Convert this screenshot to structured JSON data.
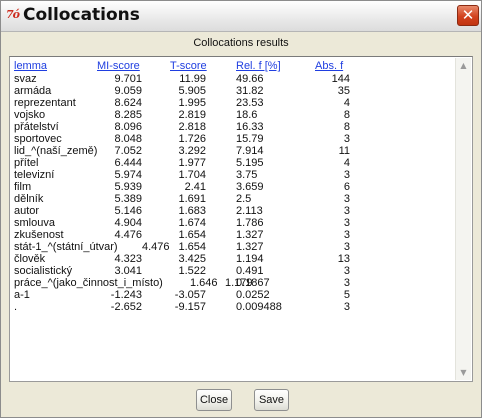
{
  "window": {
    "app_icon": "7ó",
    "title": "Collocations",
    "close_glyph": "✕"
  },
  "subtitle": "Collocations results",
  "table": {
    "headers": [
      "lemma",
      "MI-score",
      "T-score",
      "Rel. f [%]",
      "Abs. f"
    ],
    "rows": [
      [
        "svaz",
        "9.701",
        "11.99",
        "49.66",
        "144"
      ],
      [
        "armáda",
        "9.059",
        "5.905",
        "31.82",
        "35"
      ],
      [
        "reprezentant",
        "8.624",
        "1.995",
        "23.53",
        "4"
      ],
      [
        "vojsko",
        "8.285",
        "2.819",
        "18.6",
        "8"
      ],
      [
        "přátelství",
        "8.096",
        "2.818",
        "16.33",
        "8"
      ],
      [
        "sportovec",
        "8.048",
        "1.726",
        "15.79",
        "3"
      ],
      [
        "lid_^(naší_země)",
        "7.052",
        "3.292",
        "7.914",
        "11"
      ],
      [
        "přítel",
        "6.444",
        "1.977",
        "5.195",
        "4"
      ],
      [
        "televizní",
        "5.974",
        "1.704",
        "3.75",
        "3"
      ],
      [
        "film",
        "5.939",
        "2.41",
        "3.659",
        "6"
      ],
      [
        "dělník",
        "5.389",
        "1.691",
        "2.5",
        "3"
      ],
      [
        "autor",
        "5.146",
        "1.683",
        "2.113",
        "3"
      ],
      [
        "smlouva",
        "4.904",
        "1.674",
        "1.786",
        "3"
      ],
      [
        "zkušenost",
        "4.476",
        "1.654",
        "1.327",
        "3"
      ],
      [
        "stát-1_^(státní_útvar)",
        "4.476",
        "1.654",
        "1.327",
        "3"
      ],
      [
        "člověk",
        "4.323",
        "3.425",
        "1.194",
        "13"
      ],
      [
        "socialistický",
        "3.041",
        "1.522",
        "0.491",
        "3"
      ],
      [
        "práce_^(jako_činnost_i_místo)",
        "1.646",
        "1.179",
        "0.1867",
        "3"
      ],
      [
        "a-1",
        "-1.243",
        "-3.057",
        "0.0252",
        "5"
      ],
      [
        ".",
        "-2.652",
        "-9.157",
        "0.009488",
        "3"
      ]
    ]
  },
  "buttons": {
    "close": "Close",
    "save": "Save"
  },
  "icons": {
    "scroll_up": "scroll-up-arrow",
    "scroll_down": "scroll-down-arrow"
  },
  "colors": {
    "header_link": "#1f3ee0",
    "close_button": "#d2421f",
    "app_icon": "#cc2b1d"
  }
}
